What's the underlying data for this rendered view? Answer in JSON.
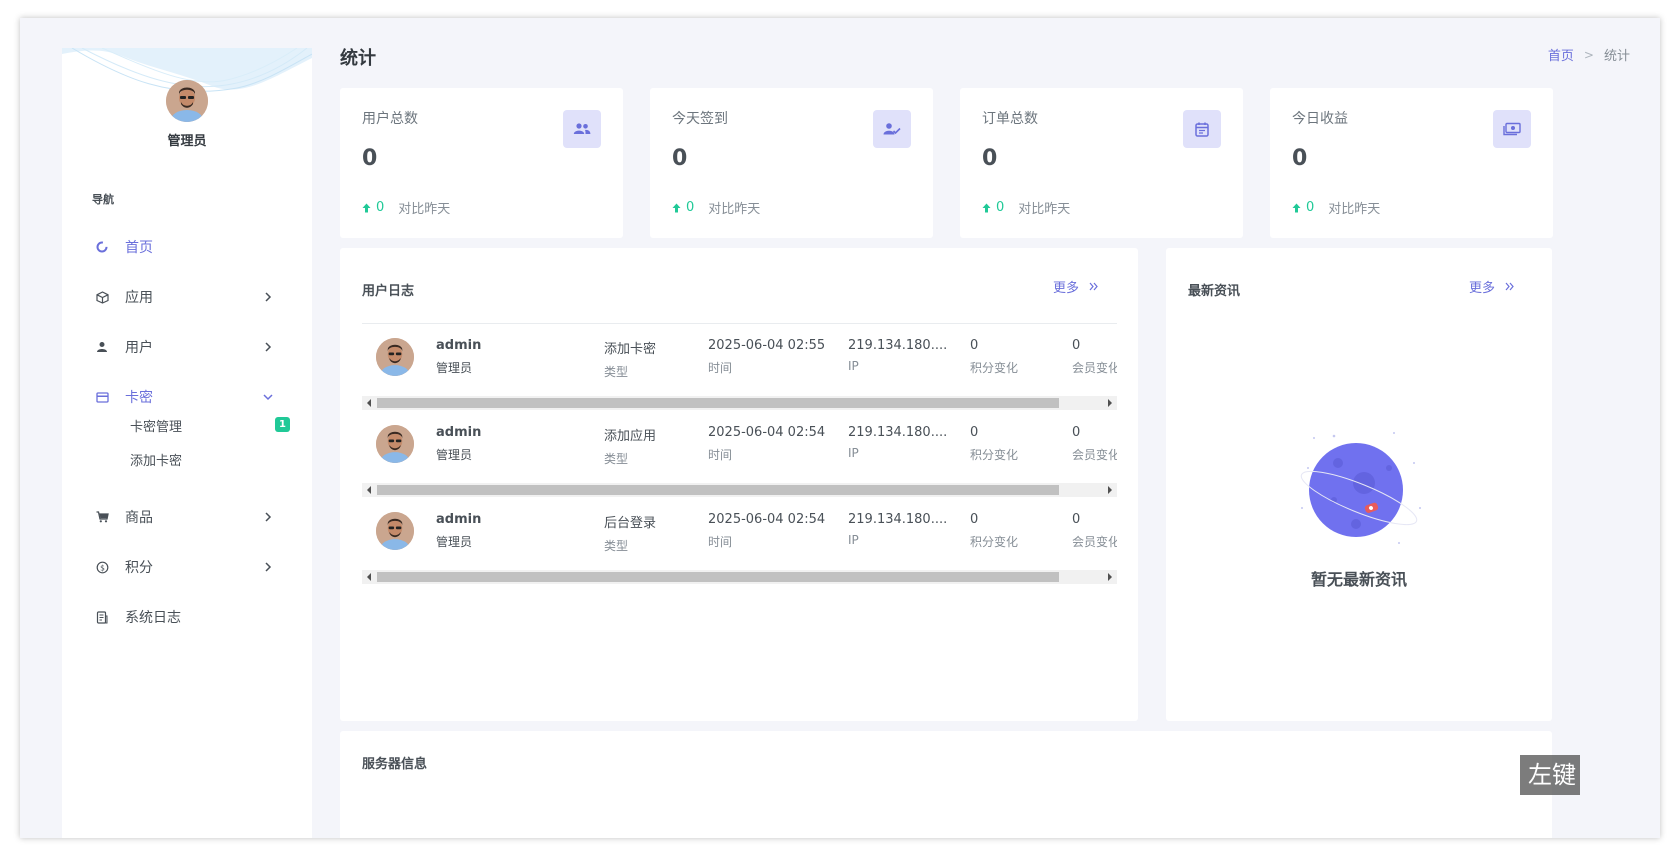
{
  "admin": {
    "name": "管理员"
  },
  "nav": {
    "title": "导航",
    "items": [
      {
        "label": "首页",
        "icon": "dashboard-icon",
        "active": true
      },
      {
        "label": "应用",
        "icon": "cube-icon"
      },
      {
        "label": "用户",
        "icon": "user-icon"
      },
      {
        "label": "卡密",
        "icon": "card-icon",
        "active": true,
        "expanded": true
      },
      {
        "label": "商品",
        "icon": "cart-icon"
      },
      {
        "label": "积分",
        "icon": "coin-icon"
      },
      {
        "label": "系统日志",
        "icon": "log-icon"
      }
    ],
    "sub_items": [
      {
        "label": "卡密管理",
        "badge": "1"
      },
      {
        "label": "添加卡密"
      }
    ]
  },
  "header": {
    "title": "统计",
    "breadcrumb": {
      "home": "首页",
      "sep": ">",
      "current": "统计"
    }
  },
  "stats": [
    {
      "label": "用户总数",
      "value": "0",
      "change": "0",
      "compare": "对比昨天",
      "icon": "users-icon"
    },
    {
      "label": "今天签到",
      "value": "0",
      "change": "0",
      "compare": "对比昨天",
      "icon": "user-check-icon"
    },
    {
      "label": "订单总数",
      "value": "0",
      "change": "0",
      "compare": "对比昨天",
      "icon": "calendar-icon"
    },
    {
      "label": "今日收益",
      "value": "0",
      "change": "0",
      "compare": "对比昨天",
      "icon": "money-icon"
    }
  ],
  "user_log": {
    "title": "用户日志",
    "more": "更多",
    "more_icon": "double-chevron-right-icon",
    "rows": [
      {
        "user": "admin",
        "role": "管理员",
        "type": "添加卡密",
        "type_label": "类型",
        "time": "2025-06-04 02:55",
        "time_label": "时间",
        "ip": "219.134.180....",
        "ip_label": "IP",
        "points": "0",
        "points_label": "积分变化",
        "vip": "0",
        "vip_label": "会员变化"
      },
      {
        "user": "admin",
        "role": "管理员",
        "type": "添加应用",
        "type_label": "类型",
        "time": "2025-06-04 02:54",
        "time_label": "时间",
        "ip": "219.134.180....",
        "ip_label": "IP",
        "points": "0",
        "points_label": "积分变化",
        "vip": "0",
        "vip_label": "会员变化"
      },
      {
        "user": "admin",
        "role": "管理员",
        "type": "后台登录",
        "type_label": "类型",
        "time": "2025-06-04 02:54",
        "time_label": "时间",
        "ip": "219.134.180....",
        "ip_label": "IP",
        "points": "0",
        "points_label": "积分变化",
        "vip": "0",
        "vip_label": "会员变化"
      }
    ]
  },
  "news": {
    "title": "最新资讯",
    "more": "更多",
    "empty": "暂无最新资讯"
  },
  "server": {
    "title": "服务器信息"
  },
  "watermark": "左键",
  "colors": {
    "accent": "#6a6fdb",
    "success": "#20c997",
    "icon_bg": "#e0e1fa"
  }
}
